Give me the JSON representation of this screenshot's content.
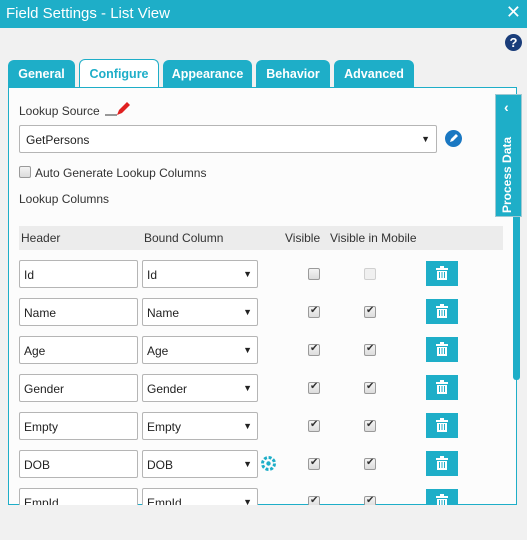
{
  "window": {
    "title": "Field Settings - List View",
    "close_icon": "close-icon",
    "help_label": "?"
  },
  "tabs": [
    {
      "label": "General",
      "active": false
    },
    {
      "label": "Configure",
      "active": true
    },
    {
      "label": "Appearance",
      "active": false
    },
    {
      "label": "Behavior",
      "active": false
    },
    {
      "label": "Advanced",
      "active": false
    }
  ],
  "configure": {
    "lookup_source_label": "Lookup Source",
    "lookup_source_value": "GetPersons",
    "auto_generate_label": "Auto Generate Lookup Columns",
    "auto_generate_checked": false,
    "lookup_columns_label": "Lookup Columns",
    "columns_header": {
      "header": "Header",
      "bound_column": "Bound Column",
      "visible": "Visible",
      "visible_in_mobile": "Visible in Mobile"
    },
    "rows": [
      {
        "header": "Id",
        "bound": "Id",
        "visible": false,
        "visible_mobile": false,
        "mobile_disabled": true,
        "settings": false
      },
      {
        "header": "Name",
        "bound": "Name",
        "visible": true,
        "visible_mobile": true,
        "mobile_disabled": false,
        "settings": false
      },
      {
        "header": "Age",
        "bound": "Age",
        "visible": true,
        "visible_mobile": true,
        "mobile_disabled": false,
        "settings": false
      },
      {
        "header": "Gender",
        "bound": "Gender",
        "visible": true,
        "visible_mobile": true,
        "mobile_disabled": false,
        "settings": false
      },
      {
        "header": "Empty",
        "bound": "Empty",
        "visible": true,
        "visible_mobile": true,
        "mobile_disabled": false,
        "settings": false
      },
      {
        "header": "DOB",
        "bound": "DOB",
        "visible": true,
        "visible_mobile": true,
        "mobile_disabled": false,
        "settings": true
      },
      {
        "header": "EmpId",
        "bound": "EmpId",
        "visible": true,
        "visible_mobile": true,
        "mobile_disabled": false,
        "settings": false
      }
    ]
  },
  "side_panel": {
    "label": "Process Data",
    "chevron": "‹"
  },
  "colors": {
    "accent": "#1eaec8",
    "help": "#1a3d7a",
    "edit": "#1a78c2",
    "required_pencil": "#e02020"
  }
}
